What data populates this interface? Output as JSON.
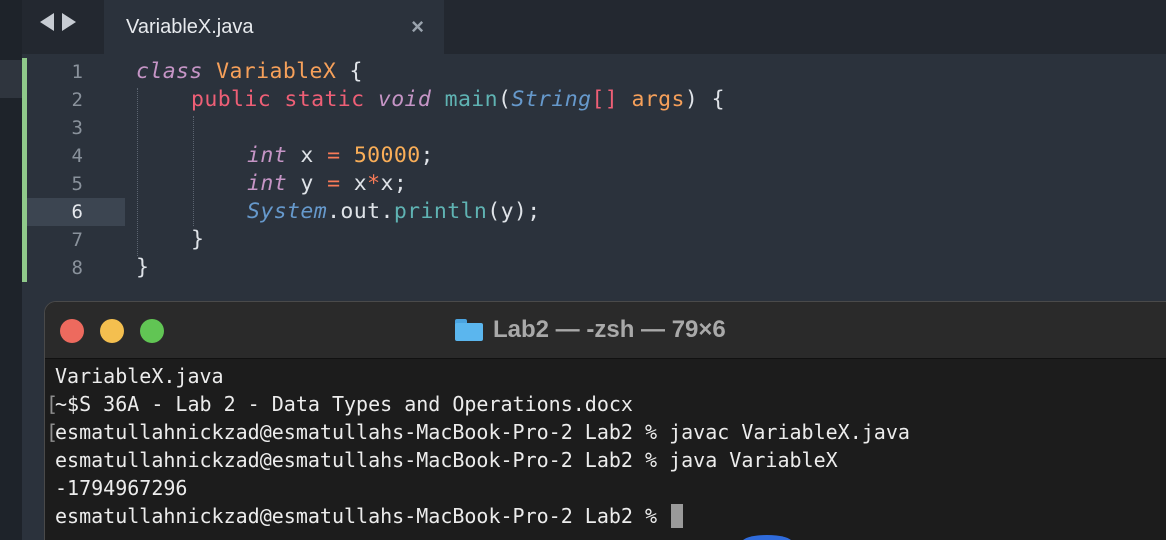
{
  "editor": {
    "tab": {
      "title": "VariableX.java",
      "close_icon": "×"
    },
    "nav": {
      "back": "back-arrow-icon",
      "forward": "forward-arrow-icon"
    },
    "line_numbers": [
      "1",
      "2",
      "3",
      "4",
      "5",
      "6",
      "7",
      "8"
    ],
    "active_line": 6,
    "code": {
      "l1": {
        "kw": "class",
        "name": "VariableX",
        "brace": " {"
      },
      "l2": {
        "mods": "public static",
        "ret": "void",
        "fn": "main",
        "paren_open": "(",
        "type": "String",
        "arr": "[]",
        "arg": "args",
        "rest": ") {"
      },
      "l4": {
        "type": "int",
        "var": " x ",
        "eq": "=",
        "val": "50000",
        "semi": ";"
      },
      "l5": {
        "type": "int",
        "var": " y ",
        "eq": "=",
        "x1": " x",
        "op": "*",
        "x2": "x",
        "semi": ";"
      },
      "l6": {
        "sys": "System",
        "dot1": ".out.",
        "fn": "println",
        "rest": "(y);"
      },
      "l7": "}",
      "l8": "}"
    }
  },
  "terminal": {
    "title": "Lab2 — -zsh — 79×6",
    "lines": [
      "VariableX.java",
      "~$S 36A - Lab 2 - Data Types and Operations.docx",
      "esmatullahnickzad@esmatullahs-MacBook-Pro-2 Lab2 % javac VariableX.java",
      "esmatullahnickzad@esmatullahs-MacBook-Pro-2 Lab2 % java VariableX",
      "-1794967296",
      "esmatullahnickzad@esmatullahs-MacBook-Pro-2 Lab2 % "
    ],
    "bracket": "[",
    "colors": {
      "close": "#ed6a5e",
      "minimize": "#f4bf4f",
      "zoom": "#61c554"
    }
  }
}
